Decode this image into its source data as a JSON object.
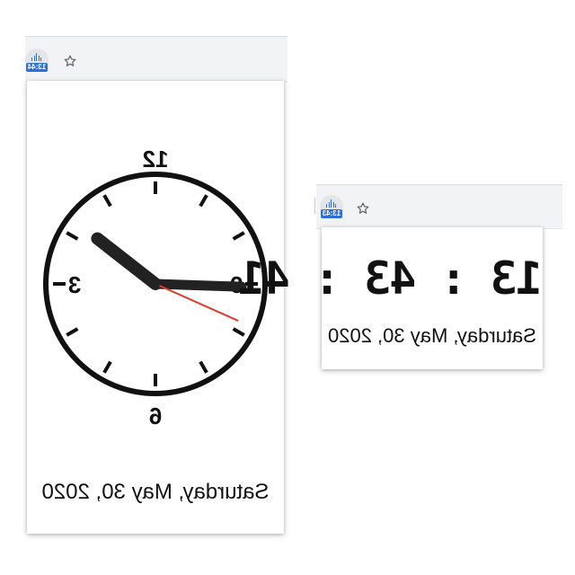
{
  "analog_window": {
    "extension_badge": "13:44",
    "icons": {
      "extension": "clock-extension-icon",
      "bookmark": "star-icon"
    },
    "clock": {
      "numerals": {
        "top": "12",
        "right": "9",
        "bottom": "6",
        "left": "3"
      },
      "time_shown": {
        "hour": 13,
        "minute": 44,
        "second": 41
      },
      "hand_colors": {
        "hour": "#222222",
        "minute": "#222222",
        "second": "#e03a2a"
      }
    },
    "date": "Saturday, May 30, 2020"
  },
  "digital_window": {
    "extension_badge": "13:43",
    "icons": {
      "extension": "clock-extension-icon",
      "bookmark": "star-icon"
    },
    "time": "13 : 43 : 41",
    "date": "Saturday, May 30, 2020"
  }
}
